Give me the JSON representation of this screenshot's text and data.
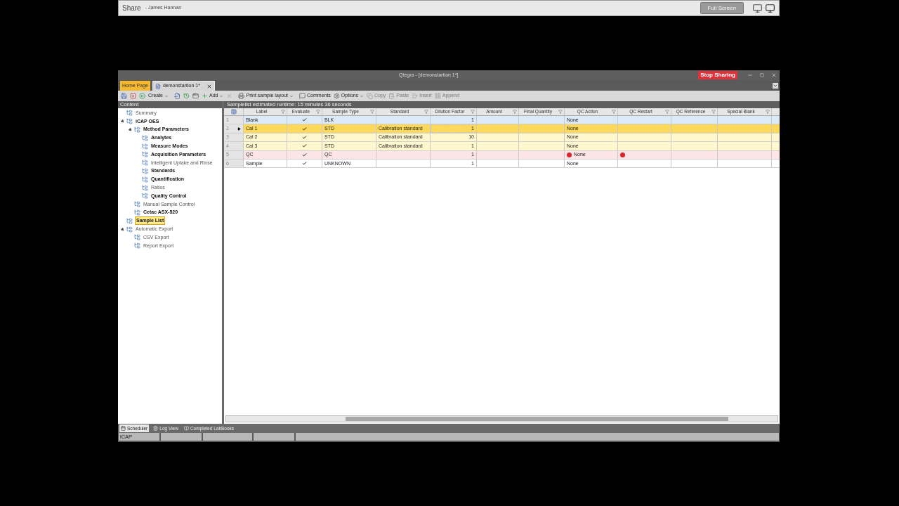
{
  "share_bar": {
    "title": "Share",
    "presenter": "- James Hannan",
    "full_screen": "Full Screen"
  },
  "window": {
    "title": "Qtegra - [demonstartion 1*]",
    "stop_sharing": "Stop Sharing"
  },
  "tabs": [
    {
      "label": "Home Page",
      "kind": "home",
      "selected": false
    },
    {
      "label": "demonstartion 1*",
      "kind": "document",
      "selected": true
    }
  ],
  "toolbar": [
    {
      "kind": "save",
      "disabled": false
    },
    {
      "kind": "discard",
      "disabled": false
    },
    {
      "kind": "run",
      "disabled": false
    },
    {
      "kind": "text",
      "label": "Create",
      "dropdown": true,
      "disabled": false
    },
    {
      "kind": "export",
      "disabled": false
    },
    {
      "kind": "history",
      "disabled": false
    },
    {
      "kind": "window",
      "disabled": false
    },
    {
      "kind": "add",
      "label": "Add",
      "dropdown": true,
      "disabled": false
    },
    {
      "kind": "delete",
      "disabled": true
    },
    {
      "kind": "print",
      "label": "Print sample layout",
      "dropdown": true,
      "disabled": false
    },
    {
      "kind": "comment",
      "label": "Comments",
      "dropdown": false,
      "disabled": false
    },
    {
      "kind": "options",
      "label": "Options",
      "dropdown": true,
      "disabled": false
    },
    {
      "kind": "copy",
      "label": "Copy",
      "dropdown": false,
      "disabled": true
    },
    {
      "kind": "paste",
      "label": "Paste",
      "dropdown": false,
      "disabled": true
    },
    {
      "kind": "insert",
      "label": "Insert",
      "dropdown": false,
      "disabled": true
    },
    {
      "kind": "append",
      "label": "Append",
      "dropdown": false,
      "disabled": true
    }
  ],
  "sidebar": {
    "title": "Content",
    "items": [
      {
        "label": "Summary",
        "bold": false,
        "selected": false
      },
      {
        "label": "iCAP OES",
        "bold": true,
        "selected": false,
        "expanded": true,
        "children": [
          {
            "label": "Method Parameters",
            "bold": true,
            "selected": false,
            "expanded": true,
            "children": [
              {
                "label": "Analytes",
                "bold": true,
                "selected": false
              },
              {
                "label": "Measure Modes",
                "bold": true,
                "selected": false
              },
              {
                "label": "Acquisition Parameters",
                "bold": true,
                "selected": false
              },
              {
                "label": "Intelligent Uptake and Rinse",
                "bold": false,
                "selected": false
              },
              {
                "label": "Standards",
                "bold": true,
                "selected": false
              },
              {
                "label": "Quantification",
                "bold": true,
                "selected": false
              },
              {
                "label": "Ratios",
                "bold": false,
                "selected": false
              },
              {
                "label": "Quality Control",
                "bold": true,
                "selected": false
              }
            ]
          },
          {
            "label": "Manual Sample Control",
            "bold": false,
            "selected": false
          },
          {
            "label": "Cetac ASX-520",
            "bold": true,
            "selected": false
          }
        ]
      },
      {
        "label": "Sample List",
        "bold": true,
        "selected": true
      },
      {
        "label": "Automatic Export",
        "bold": false,
        "selected": false,
        "expanded": true,
        "children": [
          {
            "label": "CSV Export",
            "bold": false,
            "selected": false
          },
          {
            "label": "Report Export",
            "bold": false,
            "selected": false
          }
        ]
      }
    ]
  },
  "grid": {
    "summary": "Samplelist estimated runtime: 15 minutes 36 seconds",
    "columns": [
      "Label",
      "Evaluate",
      "Sample Type",
      "Standard",
      "Dilution Factor",
      "Amount",
      "Final Quantity",
      "QC Action",
      "QC Restart",
      "QC Reference",
      "Special Blank"
    ],
    "rows": [
      {
        "number": "1",
        "kind": "blank",
        "selected": false,
        "label": "Blank",
        "evaluate": true,
        "sample_type": "BLK",
        "dilution": "1",
        "qc_action": "None",
        "qc_action_alert": false,
        "qc_restart_alert": false
      },
      {
        "number": "2",
        "kind": "standard",
        "selected": true,
        "label": "Cal 1",
        "evaluate": true,
        "sample_type": "STD",
        "standard": "Calibration standard",
        "dilution": "1",
        "qc_action": "None",
        "qc_action_alert": false,
        "qc_restart_alert": false
      },
      {
        "number": "3",
        "kind": "standard",
        "selected": false,
        "label": "Cal 2",
        "evaluate": true,
        "sample_type": "STD",
        "standard": "Calibration standard",
        "dilution": "10",
        "qc_action": "None",
        "qc_action_alert": false,
        "qc_restart_alert": false
      },
      {
        "number": "4",
        "kind": "standard",
        "selected": false,
        "label": "Cal 3",
        "evaluate": true,
        "sample_type": "STD",
        "standard": "Calibration standard",
        "dilution": "1",
        "qc_action": "None",
        "qc_action_alert": false,
        "qc_restart_alert": false
      },
      {
        "number": "5",
        "kind": "qc",
        "selected": false,
        "label": "QC",
        "evaluate": true,
        "sample_type": "QC",
        "dilution": "1",
        "qc_action": "None",
        "qc_action_alert": true,
        "qc_restart_alert": true
      },
      {
        "number": "6",
        "kind": "sample",
        "selected": false,
        "label": "Sample",
        "evaluate": true,
        "sample_type": "UNKNOWN",
        "dilution": "1",
        "qc_action": "None",
        "qc_action_alert": false,
        "qc_restart_alert": false
      }
    ]
  },
  "bottom_tabs": [
    {
      "label": "Scheduler",
      "selected": true
    },
    {
      "label": "Log View",
      "selected": false
    },
    {
      "label": "Completed LabBooks",
      "selected": false
    }
  ],
  "status_bar": [
    "iCAP"
  ]
}
